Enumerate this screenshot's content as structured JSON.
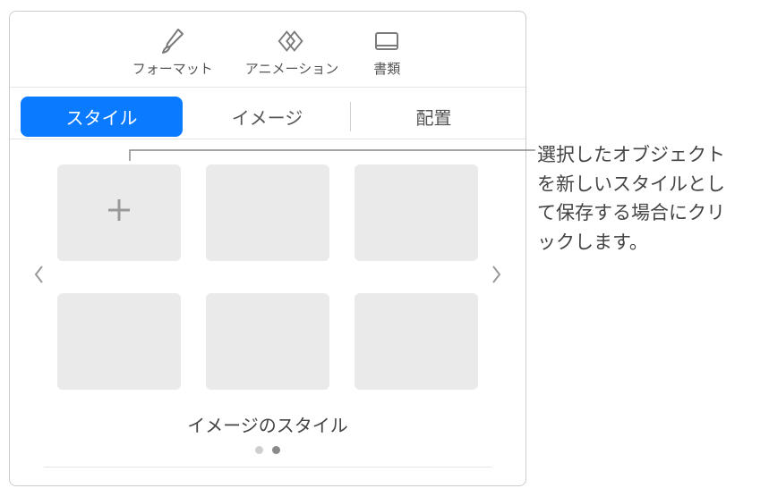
{
  "toolbar": {
    "format_label": "フォーマット",
    "animation_label": "アニメーション",
    "document_label": "書類"
  },
  "segmented": {
    "style_label": "スタイル",
    "image_label": "イメージ",
    "arrange_label": "配置"
  },
  "styles_section": {
    "title": "イメージのスタイル"
  },
  "callout": {
    "text": "選択したオブジェクトを新しいスタイルとして保存する場合にクリックします。"
  }
}
